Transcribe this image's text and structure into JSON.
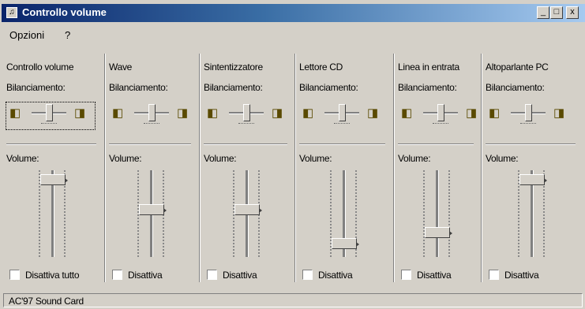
{
  "window": {
    "title": "Controllo volume",
    "icon": "speaker-window-icon",
    "controls": [
      "minimize-icon",
      "maximize-icon",
      "close-icon"
    ],
    "close_glyph": "x",
    "minimize_glyph": "_",
    "maximize_glyph": "□"
  },
  "menu": {
    "items": [
      {
        "label": "Opzioni",
        "accel_index": 0
      },
      {
        "label": "?",
        "accel_index": 0
      }
    ]
  },
  "channels": [
    {
      "name": "Controllo volume",
      "balance_label": "Bilanciamento:",
      "volume_label": "Volume:",
      "volume_level": 0.95,
      "balance": 0.5,
      "mute_label": "Disattiva tutto",
      "muted": false,
      "focused": true
    },
    {
      "name": "Wave",
      "balance_label": "Bilanciamento:",
      "volume_label": "Volume:",
      "volume_level": 0.55,
      "balance": 0.5,
      "mute_label": "Disattiva",
      "muted": false,
      "focused": false
    },
    {
      "name": "Sintentizzatore",
      "balance_label": "Bilanciamento:",
      "volume_label": "Volume:",
      "volume_level": 0.55,
      "balance": 0.5,
      "mute_label": "Disattiva",
      "muted": false,
      "focused": false
    },
    {
      "name": "Lettore CD",
      "balance_label": "Bilanciamento:",
      "volume_label": "Volume:",
      "volume_level": 0.1,
      "balance": 0.5,
      "mute_label": "Disattiva",
      "muted": false,
      "focused": false
    },
    {
      "name": "Linea in entrata",
      "balance_label": "Bilanciamento:",
      "volume_label": "Volume:",
      "volume_level": 0.25,
      "balance": 0.5,
      "mute_label": "Disattiva",
      "muted": false,
      "focused": false
    },
    {
      "name": "Altoparlante PC",
      "balance_label": "Bilanciamento:",
      "volume_label": "Volume:",
      "volume_level": 0.95,
      "balance": 0.5,
      "mute_label": "Disattiva",
      "muted": false,
      "focused": false
    }
  ],
  "status": {
    "text": "AC'97 Sound Card"
  },
  "colors": {
    "title_start": "#0a246a",
    "title_end": "#a6caf0",
    "face": "#d4d0c8"
  }
}
